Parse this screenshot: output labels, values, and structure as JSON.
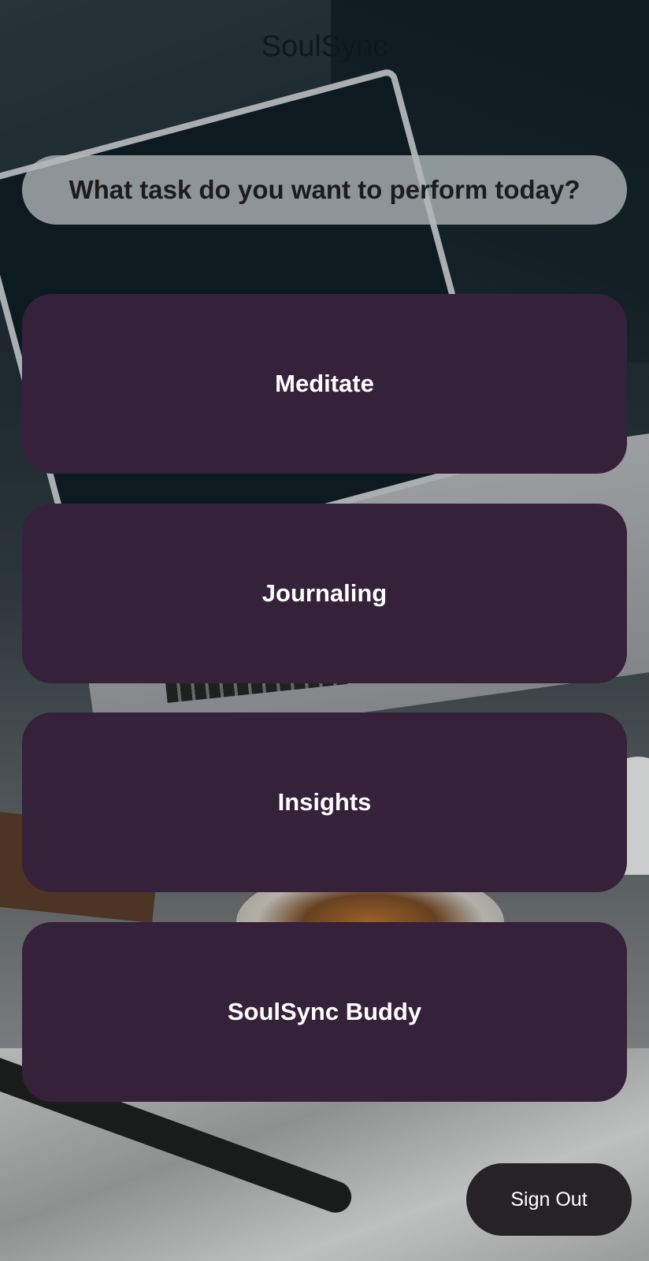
{
  "app": {
    "title": "SoulSync"
  },
  "prompt": {
    "text": "What task do you want to perform today?"
  },
  "tasks": [
    {
      "label": "Meditate"
    },
    {
      "label": "Journaling"
    },
    {
      "label": "Insights"
    },
    {
      "label": "SoulSync Buddy"
    }
  ],
  "actions": {
    "sign_out_label": "Sign Out"
  },
  "colors": {
    "task_button_bg": "#36213b",
    "prompt_bg": "#b2b8ba",
    "sign_out_bg": "#262326"
  }
}
